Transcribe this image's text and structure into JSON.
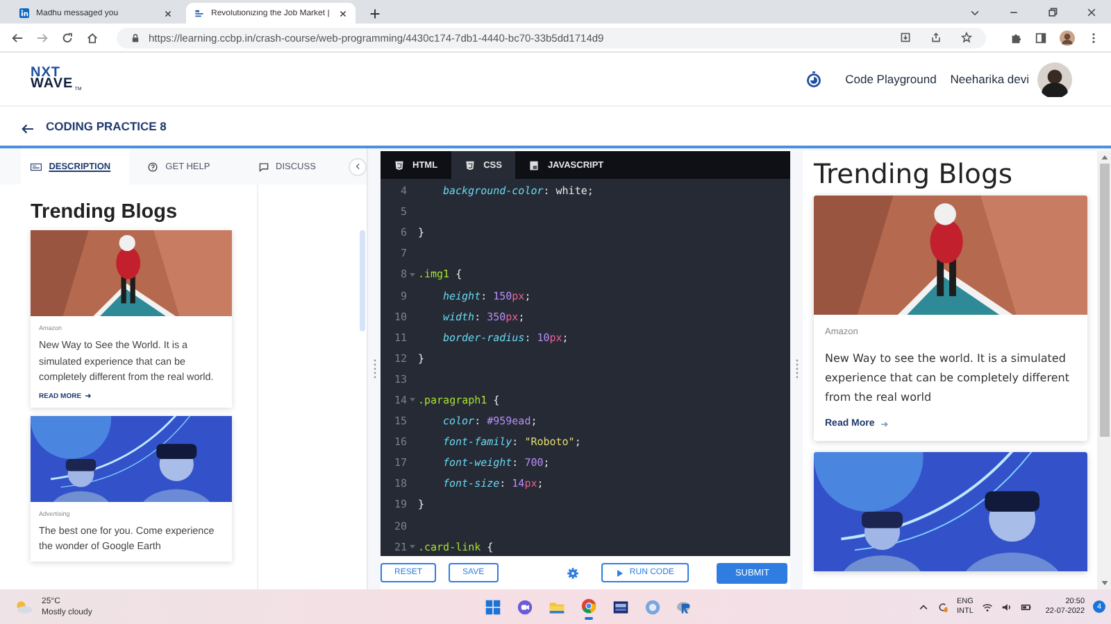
{
  "browser": {
    "tabs": [
      {
        "title": "Madhu messaged you",
        "selected": false
      },
      {
        "title": "Revolutionizing the Job Market |",
        "selected": true
      }
    ],
    "url": "https://learning.ccbp.in/crash-course/web-programming/4430c174-7db1-4440-bc70-33b5dd1714d9"
  },
  "header": {
    "logo_top": "NXT",
    "logo_bottom": "WAVE",
    "logo_mark": "TM",
    "nav_link": "Code Playground",
    "user_name": "Neeharika devi"
  },
  "page_title": "CODING PRACTICE 8",
  "left_panel": {
    "tabs": [
      {
        "label": "DESCRIPTION",
        "selected": true
      },
      {
        "label": "GET HELP",
        "selected": false
      },
      {
        "label": "DISCUSS",
        "selected": false
      }
    ],
    "heading": "Trending Blogs",
    "cards": [
      {
        "tag": "Amazon",
        "text": "New Way to See the World. It is a simulated experience that can be completely different from the real world.",
        "link": "READ MORE"
      },
      {
        "tag": "Advertising",
        "text": "The best one for you. Come experience the wonder of Google Earth"
      }
    ]
  },
  "editor": {
    "tabs": [
      {
        "label": "HTML",
        "selected": false
      },
      {
        "label": "CSS",
        "selected": true
      },
      {
        "label": "JAVASCRIPT",
        "selected": false
      }
    ],
    "lines": [
      {
        "number": "4",
        "fold": false,
        "indent": true,
        "tokens": [
          {
            "kind": "prop",
            "text": "background-color"
          },
          {
            "kind": "punct",
            "text": ": "
          },
          {
            "kind": "value",
            "text": "white"
          },
          {
            "kind": "punct",
            "text": ";"
          }
        ]
      },
      {
        "number": "5",
        "fold": false
      },
      {
        "number": "6",
        "fold": false,
        "indent": false,
        "tokens": [
          {
            "kind": "punct",
            "text": "}"
          }
        ]
      },
      {
        "number": "7",
        "fold": false
      },
      {
        "number": "8",
        "fold": true,
        "indent": false,
        "tokens": [
          {
            "kind": "selector",
            "text": ".img1"
          },
          {
            "kind": "punct",
            "text": " {"
          }
        ]
      },
      {
        "number": "9",
        "fold": false,
        "indent": true,
        "tokens": [
          {
            "kind": "prop",
            "text": "height"
          },
          {
            "kind": "punct",
            "text": ": "
          },
          {
            "kind": "number",
            "text": "150"
          },
          {
            "kind": "unit",
            "text": "px"
          },
          {
            "kind": "punct",
            "text": ";"
          }
        ]
      },
      {
        "number": "10",
        "fold": false,
        "indent": true,
        "tokens": [
          {
            "kind": "prop",
            "text": "width"
          },
          {
            "kind": "punct",
            "text": ": "
          },
          {
            "kind": "number",
            "text": "350"
          },
          {
            "kind": "unit",
            "text": "px"
          },
          {
            "kind": "punct",
            "text": ";"
          }
        ]
      },
      {
        "number": "11",
        "fold": false,
        "indent": true,
        "tokens": [
          {
            "kind": "prop",
            "text": "border-radius"
          },
          {
            "kind": "punct",
            "text": ": "
          },
          {
            "kind": "number",
            "text": "10"
          },
          {
            "kind": "unit",
            "text": "px"
          },
          {
            "kind": "punct",
            "text": ";"
          }
        ]
      },
      {
        "number": "12",
        "fold": false,
        "indent": false,
        "tokens": [
          {
            "kind": "punct",
            "text": "}"
          }
        ]
      },
      {
        "number": "13",
        "fold": false
      },
      {
        "number": "14",
        "fold": true,
        "indent": false,
        "tokens": [
          {
            "kind": "selector",
            "text": ".paragraph1"
          },
          {
            "kind": "punct",
            "text": " {"
          }
        ]
      },
      {
        "number": "15",
        "fold": false,
        "indent": true,
        "tokens": [
          {
            "kind": "prop",
            "text": "color"
          },
          {
            "kind": "punct",
            "text": ": "
          },
          {
            "kind": "number",
            "text": "#959ead"
          },
          {
            "kind": "punct",
            "text": ";"
          }
        ]
      },
      {
        "number": "16",
        "fold": false,
        "indent": true,
        "tokens": [
          {
            "kind": "prop",
            "text": "font-family"
          },
          {
            "kind": "punct",
            "text": ": "
          },
          {
            "kind": "string",
            "text": "\"Roboto\""
          },
          {
            "kind": "punct",
            "text": ";"
          }
        ]
      },
      {
        "number": "17",
        "fold": false,
        "indent": true,
        "tokens": [
          {
            "kind": "prop",
            "text": "font-weight"
          },
          {
            "kind": "punct",
            "text": ": "
          },
          {
            "kind": "number",
            "text": "700"
          },
          {
            "kind": "punct",
            "text": ";"
          }
        ]
      },
      {
        "number": "18",
        "fold": false,
        "indent": true,
        "tokens": [
          {
            "kind": "prop",
            "text": "font-size"
          },
          {
            "kind": "punct",
            "text": ": "
          },
          {
            "kind": "number",
            "text": "14"
          },
          {
            "kind": "unit",
            "text": "px"
          },
          {
            "kind": "punct",
            "text": ";"
          }
        ]
      },
      {
        "number": "19",
        "fold": false,
        "indent": false,
        "tokens": [
          {
            "kind": "punct",
            "text": "}"
          }
        ]
      },
      {
        "number": "20",
        "fold": false
      },
      {
        "number": "21",
        "fold": true,
        "indent": false,
        "tokens": [
          {
            "kind": "selector",
            "text": ".card-link"
          },
          {
            "kind": "punct",
            "text": " {"
          }
        ]
      }
    ],
    "buttons": [
      {
        "kind": "outline",
        "label": "RESET"
      },
      {
        "kind": "outline",
        "label": "SAVE"
      },
      {
        "kind": "settings"
      },
      {
        "kind": "run",
        "label": "RUN CODE"
      },
      {
        "kind": "primary",
        "label": "SUBMIT"
      }
    ]
  },
  "preview": {
    "heading": "Trending Blogs",
    "cards": [
      {
        "kind": "blog",
        "tag": "Amazon",
        "text": "New Way to see the world. It is a simulated experience that can be completely different from the real world",
        "link": "Read More"
      },
      {
        "kind": "picture"
      }
    ]
  },
  "taskbar": {
    "temperature": "25°C",
    "weather": "Mostly cloudy",
    "language": "ENG",
    "layout": "INTL",
    "time": "20:50",
    "date": "22-07-2022",
    "notifications": "4"
  }
}
